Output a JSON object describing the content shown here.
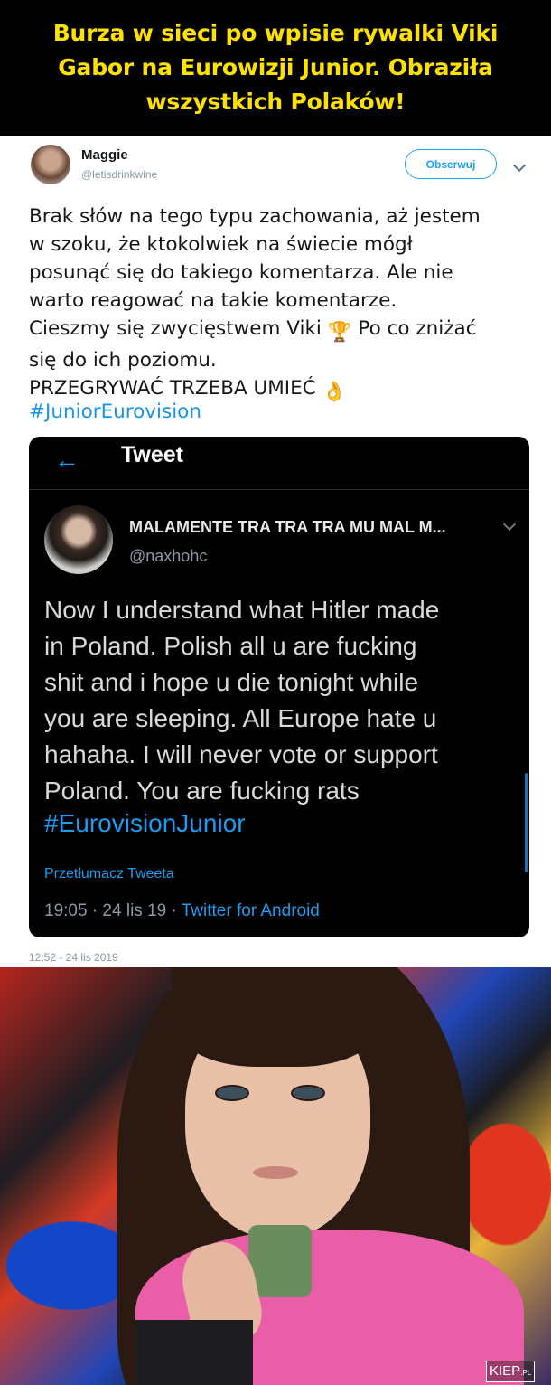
{
  "headline": {
    "text": "Burza w sieci po wpisie rywalki Viki Gabor na Eurowizji Junior. Obraziła wszystkich Polaków!"
  },
  "tweet": {
    "author_name": "Maggie",
    "author_handle": "@letisdrinkwine",
    "follow_label": "Obserwuj",
    "text_before_trophy": "Brak słów na tego typu zachowania, aż jestem\nw szoku, że ktokolwiek na świecie mógł\nposunąć się do takiego komentarza. Ale nie\nwarto reagować na takie komentarze.\nCieszmy się zwycięstwem Viki ",
    "trophy_emoji": "🏆",
    "text_after_trophy": " Po co zniżać\nsię do ich poziomu.\nPRZEGRYWAĆ TRZEBA UMIEĆ ",
    "ok_emoji": "👌",
    "hashtag": "#JuniorEurovision",
    "timestamp": "12:52 - 24 lis 2019"
  },
  "embedded": {
    "header_title": "Tweet",
    "author_name": "MALAMENTE TRA TRA TRA MU MAL M...",
    "author_handle": "@naxhohc",
    "text": "Now I understand what Hitler made\nin Poland. Polish all u are fucking\nshit and i hope u die tonight while\nyou are sleeping. All Europe hate u\nhahaha. I will never vote or support\nPoland. You are fucking rats",
    "hashtag": "#EurovisionJunior",
    "translate_label": "Przetłumacz Tweeta",
    "meta_time": "19:05 · 24 lis 19 · ",
    "meta_source": "Twitter for Android"
  },
  "watermark": {
    "main": "KIEP",
    "suffix": ".PL"
  },
  "colors": {
    "headline_bg": "#000000",
    "headline_text": "#ffe100",
    "twitter_blue": "#1da1f2",
    "embed_bg": "#000000"
  },
  "icons": {
    "back": "arrow-left-icon",
    "chevron": "chevron-down-icon"
  }
}
